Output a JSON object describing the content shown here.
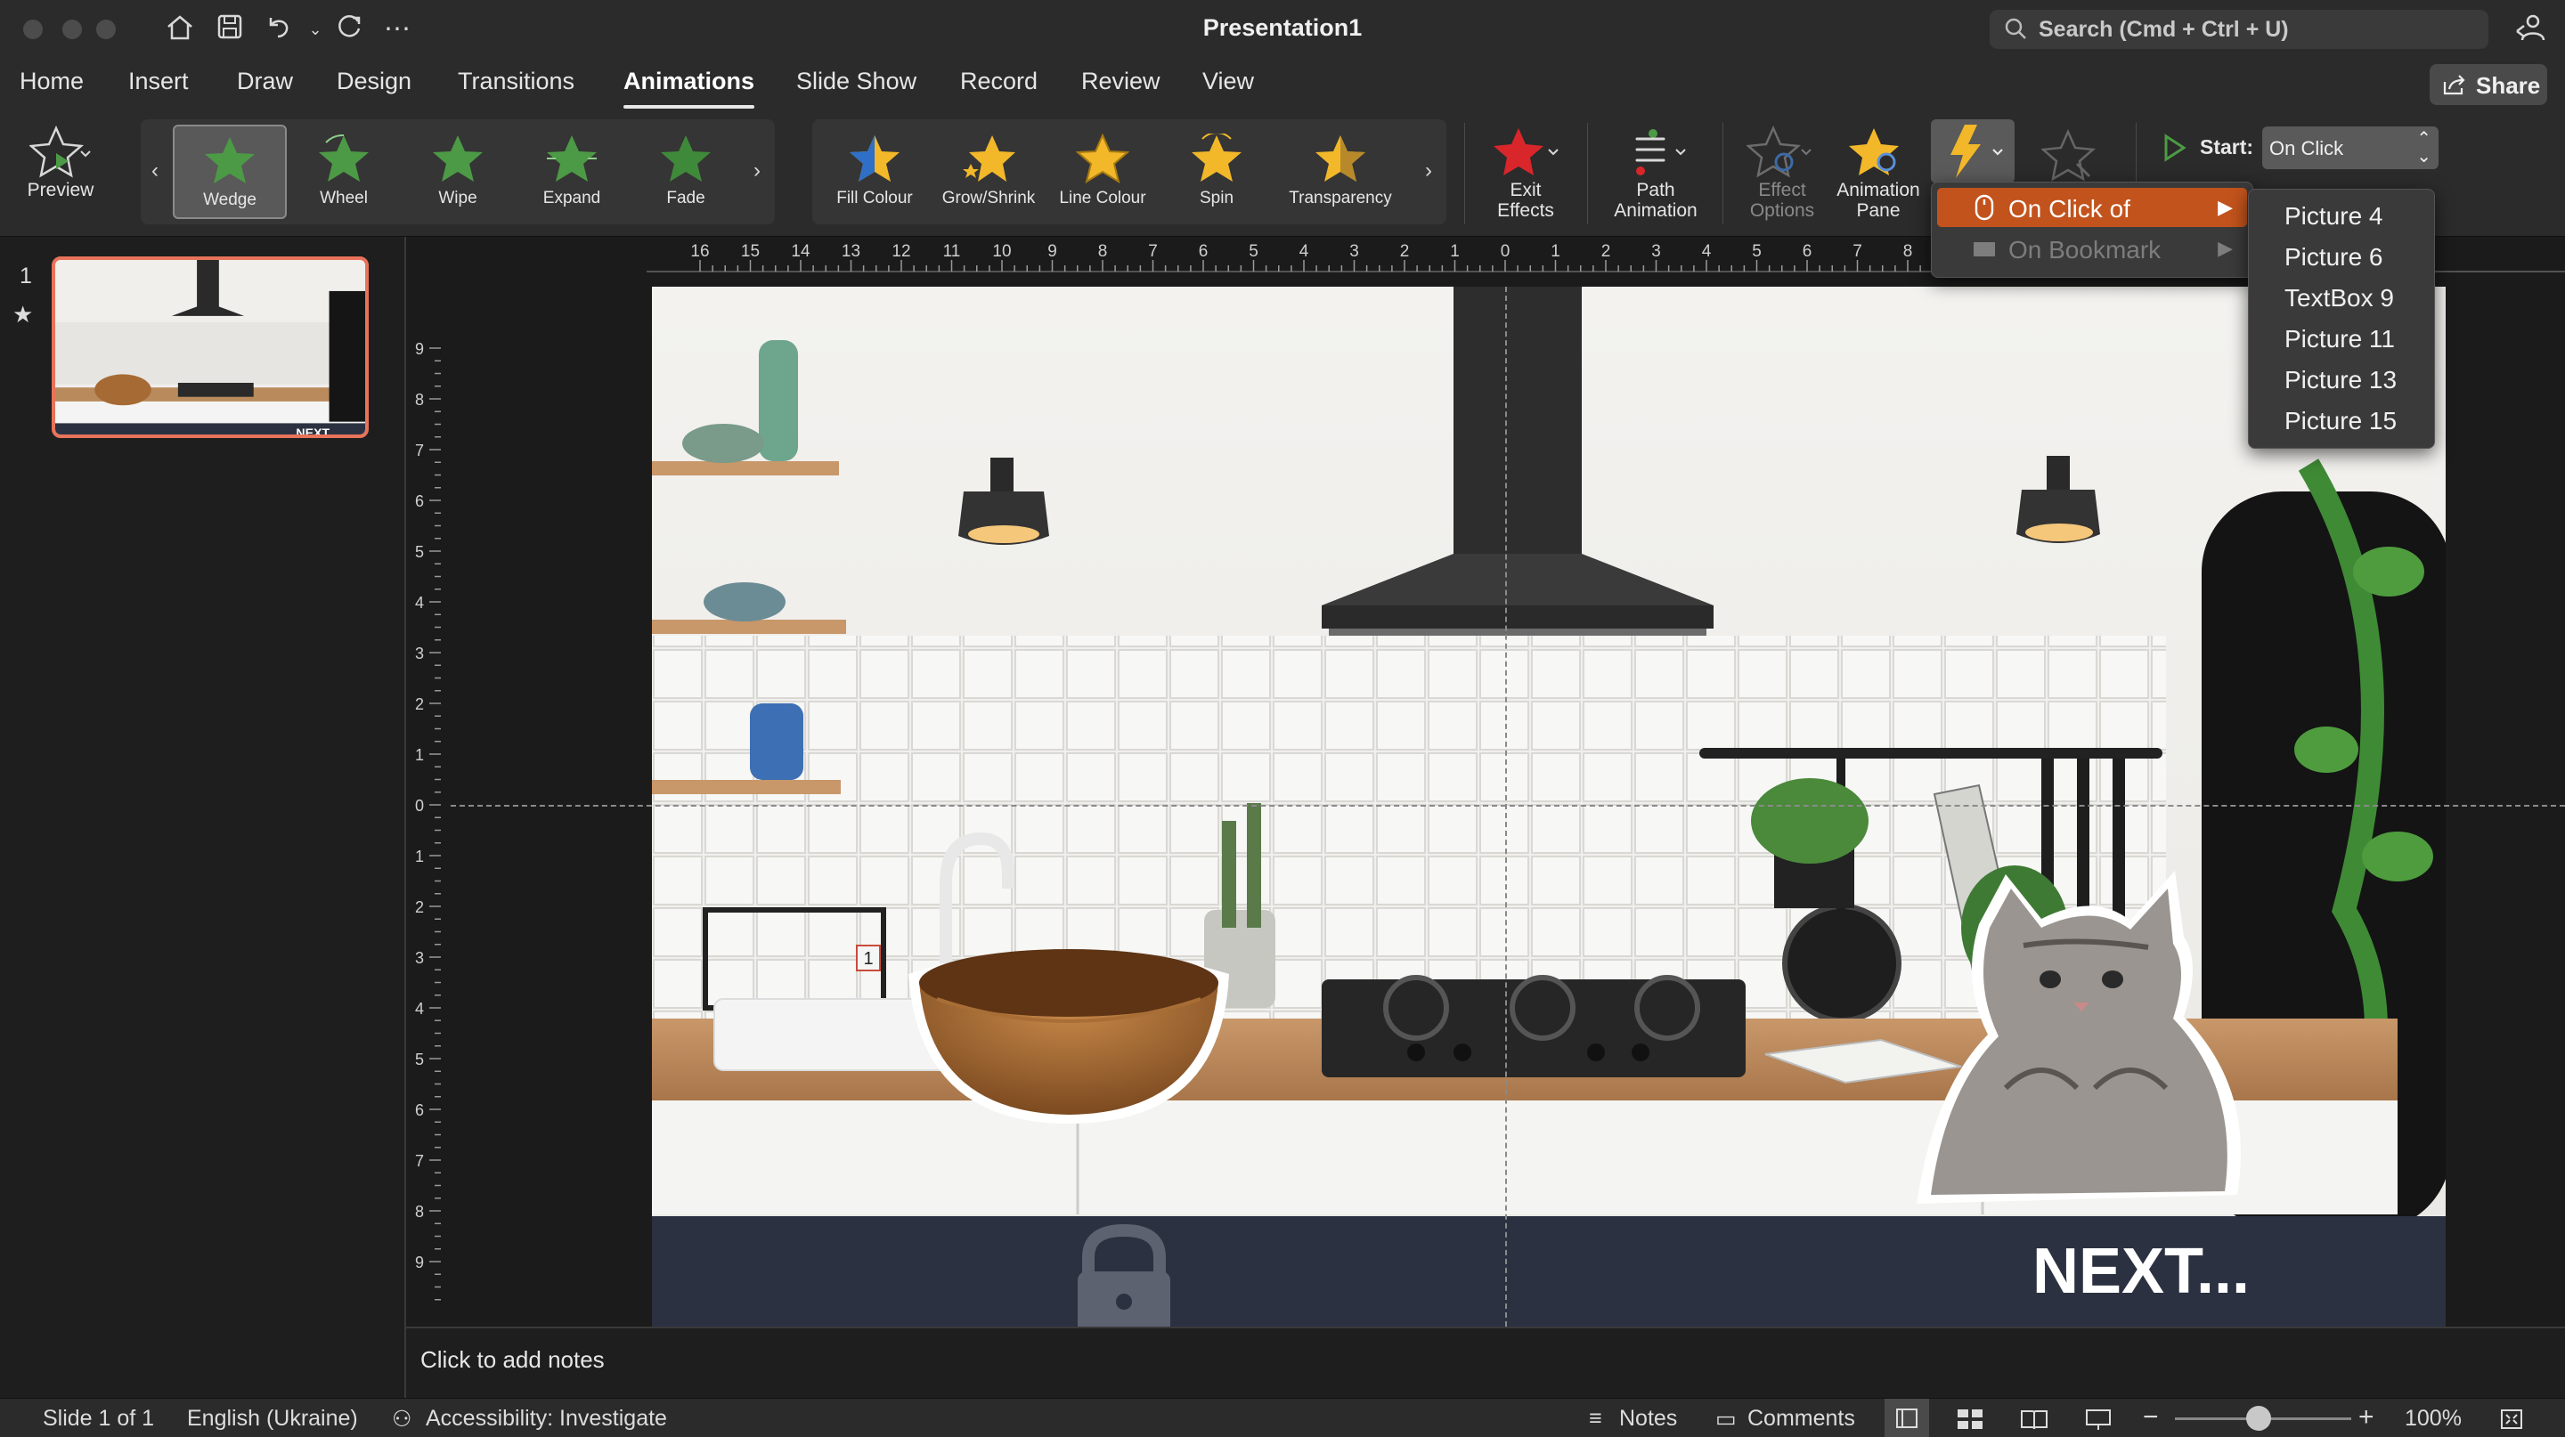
{
  "window": {
    "title": "Presentation1",
    "search_placeholder": "Search (Cmd + Ctrl + U)"
  },
  "tabs": [
    "Home",
    "Insert",
    "Draw",
    "Design",
    "Transitions",
    "Animations",
    "Slide Show",
    "Record",
    "Review",
    "View"
  ],
  "active_tab": "Animations",
  "share_label": "Share",
  "ribbon": {
    "preview_label": "Preview",
    "entrance_effects": [
      "Wedge",
      "Wheel",
      "Wipe",
      "Expand",
      "Fade"
    ],
    "selected_effect": "Wedge",
    "emphasis_effects": [
      "Fill Colour",
      "Grow/Shrink",
      "Line Colour",
      "Spin",
      "Transparency"
    ],
    "exit_effects": [
      "Exit",
      "Effects"
    ],
    "path_animation": [
      "Path",
      "Animation"
    ],
    "effect_options": [
      "Effect",
      "Options"
    ],
    "animation_pane": [
      "Animation",
      "Pane"
    ],
    "start_label": "Start:",
    "start_value": "On Click"
  },
  "trigger_menu": {
    "items": [
      {
        "label": "On Click of",
        "state": "highlighted"
      },
      {
        "label": "On Bookmark",
        "state": "disabled"
      }
    ],
    "submenu": [
      "Picture 4",
      "Picture 6",
      "TextBox 9",
      "Picture 11",
      "Picture 13",
      "Picture 15"
    ]
  },
  "slides_panel": {
    "slide_number": "1",
    "thumb_text": "NEXT..."
  },
  "ruler": {
    "h_labels": [
      "16",
      "15",
      "14",
      "13",
      "12",
      "11",
      "10",
      "9",
      "8",
      "7",
      "6",
      "5",
      "4",
      "3",
      "2",
      "1",
      "0",
      "1",
      "2",
      "3",
      "4",
      "5",
      "6",
      "7",
      "8"
    ],
    "v_labels": [
      "9",
      "8",
      "7",
      "6",
      "5",
      "4",
      "3",
      "2",
      "1",
      "0",
      "1",
      "2",
      "3",
      "4",
      "5",
      "6",
      "7",
      "8",
      "9"
    ]
  },
  "slide": {
    "next_text": "NEXT...",
    "animation_tag": "1"
  },
  "notes_placeholder": "Click to add notes",
  "status": {
    "slide_info": "Slide 1 of 1",
    "language": "English (Ukraine)",
    "accessibility": "Accessibility: Investigate",
    "notes": "Notes",
    "comments": "Comments",
    "zoom": "100%"
  },
  "colors": {
    "accent_orange": "#c2531c",
    "thumb_border": "#e8735a",
    "green_star": "#4c9a45",
    "gold_star": "#f2b82a",
    "red_star": "#d9262a"
  }
}
